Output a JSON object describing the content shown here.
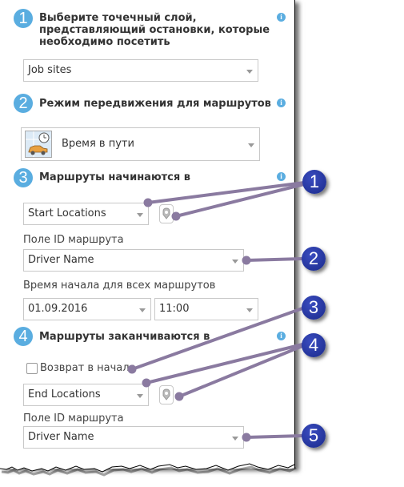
{
  "sections": [
    {
      "number": "1",
      "title_lines": [
        "Выберите точечный слой,",
        "представляющий остановки, которые",
        "необходимо посетить"
      ]
    },
    {
      "number": "2",
      "title": "Режим передвижения для маршрутов"
    },
    {
      "number": "3",
      "title": "Маршруты начинаются в"
    },
    {
      "number": "4",
      "title": "Маршруты заканчиваются в"
    }
  ],
  "info_icon": "i",
  "stops_layer": {
    "value": "Job sites"
  },
  "travel_mode": {
    "value": "Время в пути",
    "icon": "car-clock-icon"
  },
  "start": {
    "layer_value": "Start Locations",
    "route_id_label": "Поле ID маршрута",
    "route_id_value": "Driver Name",
    "start_time_label": "Время начала для всех маршрутов",
    "date_value": "01.09.2016",
    "time_value": "11:00"
  },
  "end": {
    "return_to_start_label": "Возврат в начало",
    "return_to_start_checked": false,
    "layer_value": "End Locations",
    "route_id_label": "Поле ID маршрута",
    "route_id_value": "Driver Name"
  },
  "callouts": [
    "1",
    "2",
    "3",
    "4",
    "5"
  ],
  "colors": {
    "step_badge": "#5aade0",
    "callout": "#1f2f9a",
    "leader_line": "#8a7aa0"
  }
}
